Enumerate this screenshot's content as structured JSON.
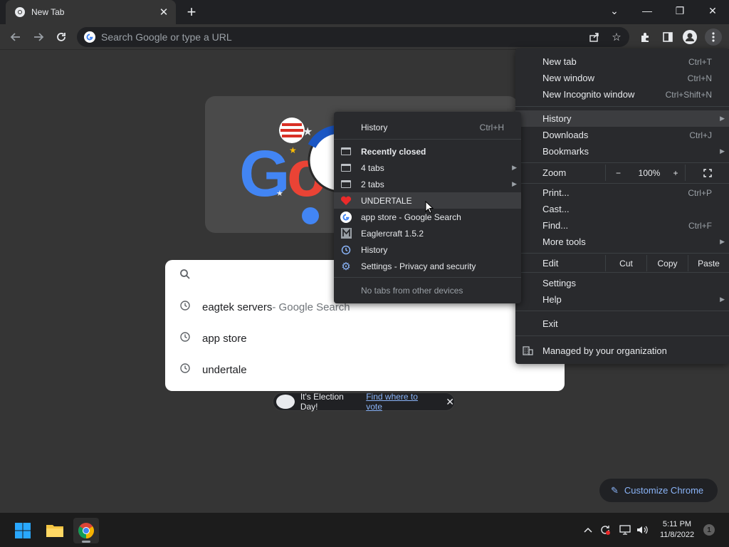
{
  "browser": {
    "tab": {
      "title": "New Tab",
      "close": "✕"
    },
    "new_tab_symbol": "+",
    "window_controls": {
      "tab_search": "⌄",
      "minimize": "—",
      "restore": "❐",
      "close": "✕"
    },
    "omnibox": {
      "placeholder": "Search Google or type a URL"
    },
    "icons": [
      "back-icon",
      "forward-icon",
      "reload-icon",
      "share-icon",
      "star-icon",
      "extensions-icon",
      "side-panel-icon",
      "profile-icon",
      "kebab-menu-icon"
    ]
  },
  "ntp": {
    "suggestions": [
      {
        "text": "eagtek servers",
        "suffix": " - Google Search"
      },
      {
        "text": "app store",
        "suffix": ""
      },
      {
        "text": "undertale",
        "suffix": ""
      }
    ],
    "election": {
      "text": "It's Election Day!",
      "link": "Find where to vote",
      "close": "✕"
    },
    "customize": "Customize Chrome"
  },
  "menu": {
    "new_tab": {
      "label": "New tab",
      "shortcut": "Ctrl+T"
    },
    "new_window": {
      "label": "New window",
      "shortcut": "Ctrl+N"
    },
    "incognito": {
      "label": "New Incognito window",
      "shortcut": "Ctrl+Shift+N"
    },
    "history": {
      "label": "History"
    },
    "downloads": {
      "label": "Downloads",
      "shortcut": "Ctrl+J"
    },
    "bookmarks": {
      "label": "Bookmarks"
    },
    "zoom": {
      "label": "Zoom",
      "minus": "−",
      "level": "100%",
      "plus": "+"
    },
    "print": {
      "label": "Print...",
      "shortcut": "Ctrl+P"
    },
    "cast": {
      "label": "Cast..."
    },
    "find": {
      "label": "Find...",
      "shortcut": "Ctrl+F"
    },
    "more_tools": {
      "label": "More tools"
    },
    "edit": {
      "label": "Edit",
      "cut": "Cut",
      "copy": "Copy",
      "paste": "Paste"
    },
    "settings": {
      "label": "Settings"
    },
    "help": {
      "label": "Help"
    },
    "exit": {
      "label": "Exit"
    },
    "managed": {
      "label": "Managed by your organization"
    }
  },
  "history_submenu": {
    "history": {
      "label": "History",
      "shortcut": "Ctrl+H"
    },
    "recently_closed": "Recently closed",
    "items": [
      {
        "label": "4 tabs",
        "icon": "window-icon",
        "arrow": true
      },
      {
        "label": "2 tabs",
        "icon": "window-icon",
        "arrow": true
      },
      {
        "label": "UNDERTALE",
        "icon": "heart-icon"
      },
      {
        "label": "app store - Google Search",
        "icon": "google-icon"
      },
      {
        "label": "Eaglercraft 1.5.2",
        "icon": "m-icon"
      },
      {
        "label": "History",
        "icon": "history-icon"
      },
      {
        "label": "Settings - Privacy and security",
        "icon": "gear-icon"
      }
    ],
    "no_tabs": "No tabs from other devices"
  },
  "taskbar": {
    "time": "5:11 PM",
    "date": "11/8/2022",
    "notifications": "1"
  },
  "colors": {
    "accent": "#8ab4f8",
    "menu_bg": "#292a2d",
    "page_bg": "#353535"
  }
}
